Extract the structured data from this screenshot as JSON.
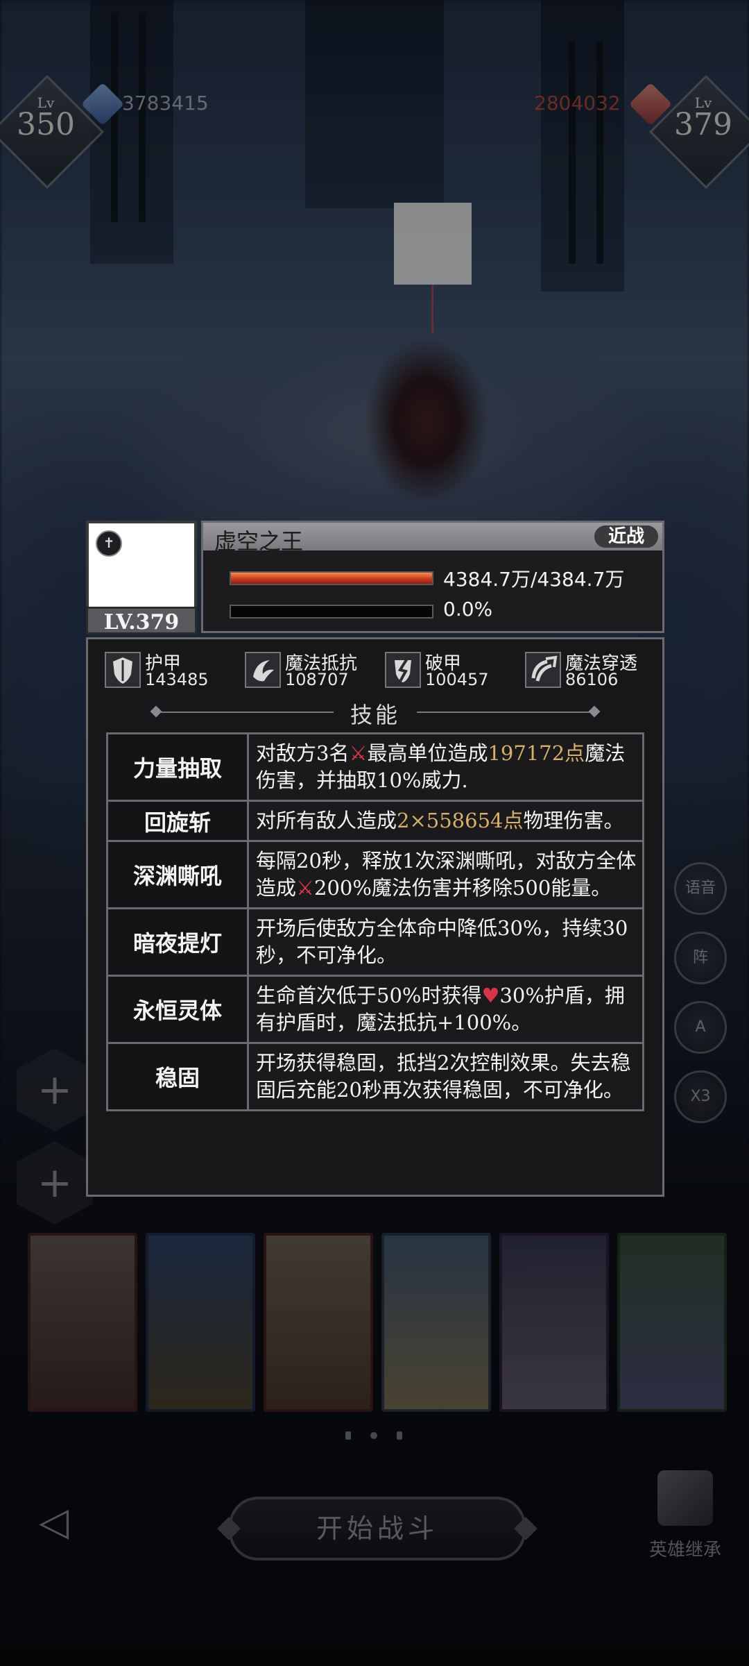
{
  "hud": {
    "player": {
      "level_prefix": "Lv",
      "level": "350",
      "power": "3783415"
    },
    "enemy": {
      "level_prefix": "Lv",
      "level": "379",
      "power": "2804032"
    }
  },
  "boss_info": {
    "name": "虚空之王",
    "tag": "近战",
    "level_label": "LV.379",
    "hp_text": "4384.7万/4384.7万",
    "hp_fraction": 1.0,
    "energy_text": "0.0%",
    "energy_fraction": 0.0,
    "stats": [
      {
        "icon": "armor-icon",
        "label": "护甲",
        "value": "143485"
      },
      {
        "icon": "magic-resist-icon",
        "label": "魔法抵抗",
        "value": "108707"
      },
      {
        "icon": "armor-break-icon",
        "label": "破甲",
        "value": "100457"
      },
      {
        "icon": "magic-penetration-icon",
        "label": "魔法穿透",
        "value": "86106"
      }
    ],
    "skills_title": "技能",
    "skills": [
      {
        "name": "力量抽取",
        "parts": [
          [
            "对敌方3名",
            ""
          ],
          [
            "⚔",
            "x"
          ],
          [
            "最高单位造成",
            ""
          ],
          [
            "197172点",
            "hl"
          ],
          [
            "魔法伤害，并抽取10%威力.",
            ""
          ]
        ]
      },
      {
        "name": "回旋斩",
        "parts": [
          [
            "对所有敌人造成",
            ""
          ],
          [
            "2×558654点",
            "hl"
          ],
          [
            "物理伤害。",
            ""
          ]
        ]
      },
      {
        "name": "深渊嘶吼",
        "parts": [
          [
            "每隔20秒，释放1次深渊嘶吼，对敌方全体造成",
            ""
          ],
          [
            "⚔",
            "x"
          ],
          [
            "200%魔法伤害并移除500能量。",
            ""
          ]
        ]
      },
      {
        "name": "暗夜提灯",
        "parts": [
          [
            "开场后使敌方全体命中降低30%，持续30秒，不可净化。",
            ""
          ]
        ]
      },
      {
        "name": "永恒灵体",
        "parts": [
          [
            "生命首次低于50%时获得",
            ""
          ],
          [
            "♥",
            "heart"
          ],
          [
            "30%护盾，拥有护盾时，魔法抵抗+100%。",
            ""
          ]
        ]
      },
      {
        "name": "稳固",
        "parts": [
          [
            "开场获得稳固，抵挡2次控制效果。失去稳固后充能20秒再次获得稳固，不可净化。",
            ""
          ]
        ]
      }
    ]
  },
  "side_buttons": [
    "语音",
    "阵",
    "A",
    "X3"
  ],
  "bottom": {
    "start_label": "开始战斗",
    "inherit_label": "英雄继承"
  },
  "colors": {
    "highlight": "#d8b06a",
    "damage_icon": "#e0384a",
    "hp_bar": "#d0451f"
  }
}
